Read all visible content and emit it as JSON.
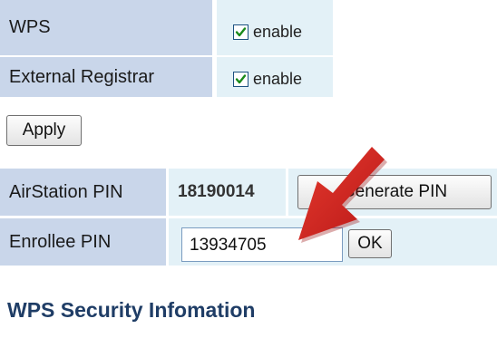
{
  "wps_table": {
    "rows": [
      {
        "label": "WPS",
        "checkbox_checked": true,
        "checkbox_label": "enable"
      },
      {
        "label": "External Registrar",
        "checkbox_checked": true,
        "checkbox_label": "enable"
      }
    ]
  },
  "apply_button": {
    "label": "Apply"
  },
  "pin_table": {
    "airstation_pin": {
      "label": "AirStation PIN",
      "value": "18190014",
      "generate_button_label": "Generate PIN"
    },
    "enrollee_pin": {
      "label": "Enrollee PIN",
      "input_value": "13934705",
      "ok_button_label": "OK"
    }
  },
  "security_section": {
    "heading": "WPS Security Infomation"
  },
  "annotation": {
    "arrow_color": "#d42020",
    "icon": "red-arrow-icon"
  },
  "colors": {
    "label_cell": "#c9d6ea",
    "value_cell": "#e3f1f7",
    "heading": "#1f3d66"
  }
}
